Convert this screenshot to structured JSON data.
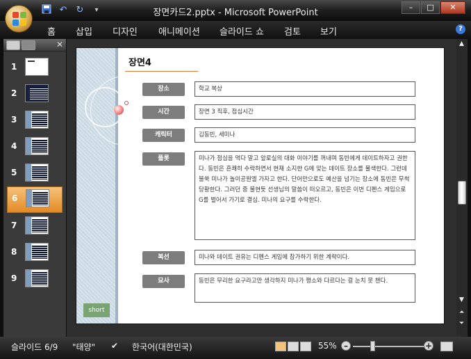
{
  "window": {
    "title": "장면카드2.pptx - Microsoft PowerPoint",
    "controls": {
      "minimize": "–",
      "maximize": "□",
      "close": "✕"
    }
  },
  "ribbon_tabs": [
    "홈",
    "삽입",
    "디자인",
    "애니메이션",
    "슬라이드 쇼",
    "검토",
    "보기"
  ],
  "thumbnails": [
    {
      "number": "1"
    },
    {
      "number": "2"
    },
    {
      "number": "3"
    },
    {
      "number": "4"
    },
    {
      "number": "5"
    },
    {
      "number": "6"
    },
    {
      "number": "7"
    },
    {
      "number": "8"
    },
    {
      "number": "9"
    }
  ],
  "slide": {
    "title": "장면4",
    "rows": [
      {
        "label": "장소",
        "text": "학교 복상"
      },
      {
        "label": "시간",
        "text": "장면 3 직후, 점심시간"
      },
      {
        "label": "캐릭터",
        "text": "김동빈, 세미나"
      },
      {
        "label": "플롯",
        "text": "미나가 점심을 먹다 말고 앞로실의 대화 이야기를 꺼내며 동빈에게 데이트하자고 권한다. 동빈은 흔쾌히 수락하면서 현재 소지한 G에 맞는 데이트 장소를 물색한다. 그런데 불쑥 미나가 놀이공원엘 가자고 한다. 단어만으로도 예산을 넘기는 장소에 동빈은 무척 당황한다. 그러던 중 불현듯 선생님의 말씀이 떠오르고, 동빈은 이번 디펜스 게임으로 G를 벌어서 가기로 결심. 미나의 요구를 수락한다."
      },
      {
        "label": "복선",
        "text": "미나와 데이트 권유는 디펜스 게임에 참가하기 위한 계략이다."
      },
      {
        "label": "묘사",
        "text": "동빈은 무리한 요구라고만 생각하지 미나가 평소와 다르다는 걸 눈치 못 챈다."
      }
    ],
    "tag": "short"
  },
  "status": {
    "slide_info": "슬라이드 6/9",
    "theme": "\"태양\"",
    "language": "한국어(대한민국)",
    "zoom": "55%"
  }
}
